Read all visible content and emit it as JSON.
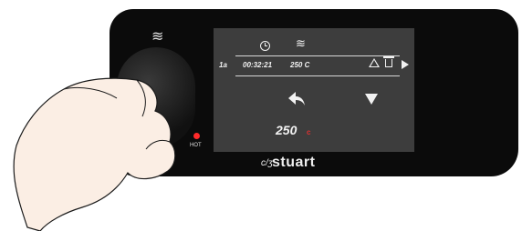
{
  "colors": {
    "panel": "#0b0b0b",
    "screen": "#3d3d3d",
    "text": "#f2f2f2",
    "accent_red": "#e03030"
  },
  "controls": {
    "knob_icon": "heat-waves-icon",
    "hot_label": "HOT"
  },
  "screen": {
    "top_icons": [
      "clock-icon",
      "heat-waves-icon"
    ],
    "program_row": {
      "id": "1a",
      "time": "00:32:21",
      "temperature": "250 C",
      "icons": [
        "warning-icon",
        "trash-icon",
        "play-icon"
      ]
    },
    "nav_icons": [
      "back-arrow-icon",
      "down-arrow-icon"
    ],
    "current_temperature": "250",
    "current_unit": "c"
  },
  "brand": {
    "name": "stuart",
    "mark": "c/ʒ"
  }
}
